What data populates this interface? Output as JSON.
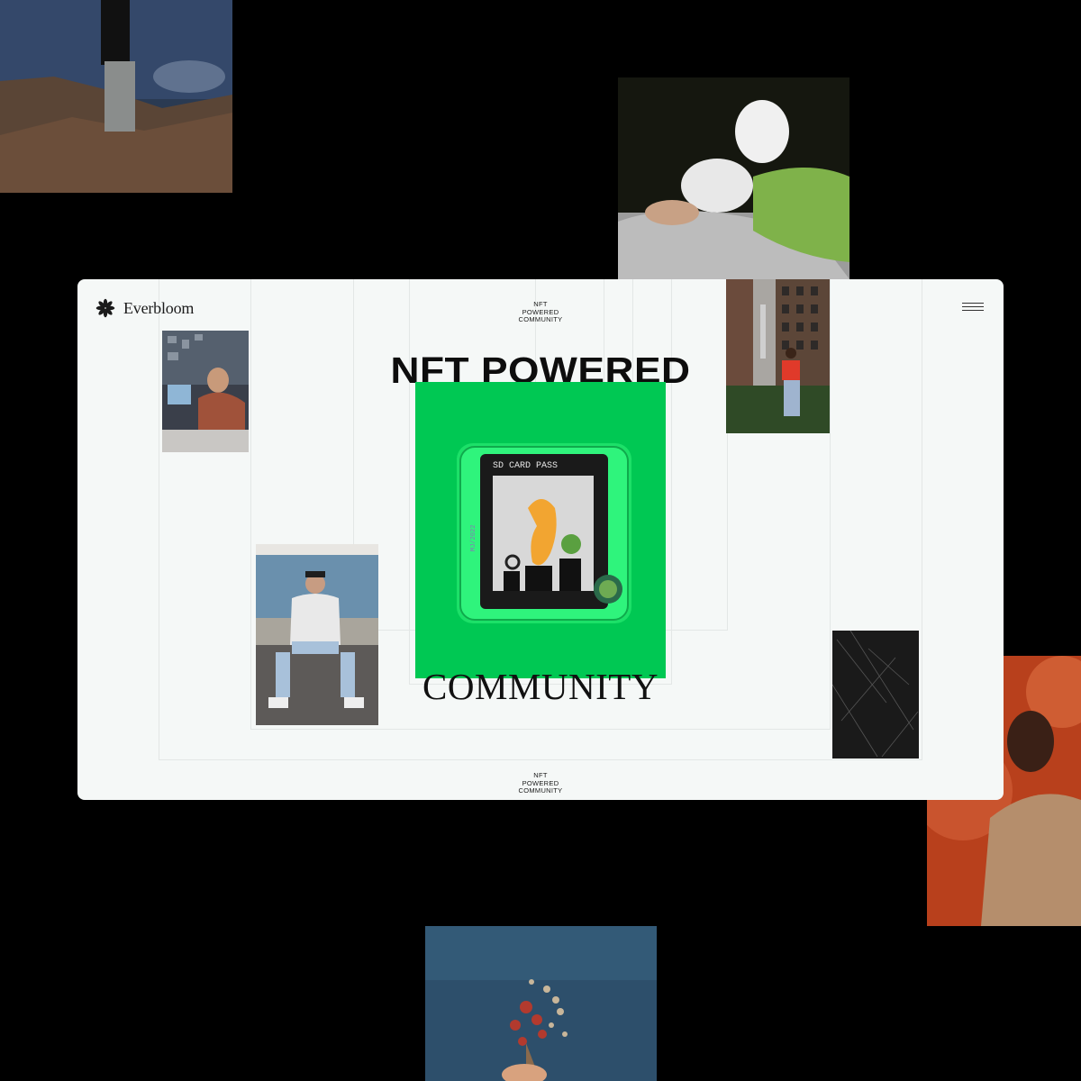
{
  "brand": {
    "name": "Everbloom",
    "logo_icon": "flower-logo-icon"
  },
  "header": {
    "stack_label": [
      "NFT",
      "POWERED",
      "COMMUNITY"
    ]
  },
  "hero": {
    "title": "NFT POWERED",
    "subtitle": "COMMUNITY"
  },
  "nft_card": {
    "label": "SD CARD PASS",
    "side_text": "MJ/2022"
  },
  "footer": {
    "stack_label": [
      "NFT",
      "POWERED",
      "COMMUNITY"
    ]
  },
  "colors": {
    "accent_green": "#00c853",
    "page_bg": "#000000",
    "window_bg": "#f5f8f7"
  }
}
